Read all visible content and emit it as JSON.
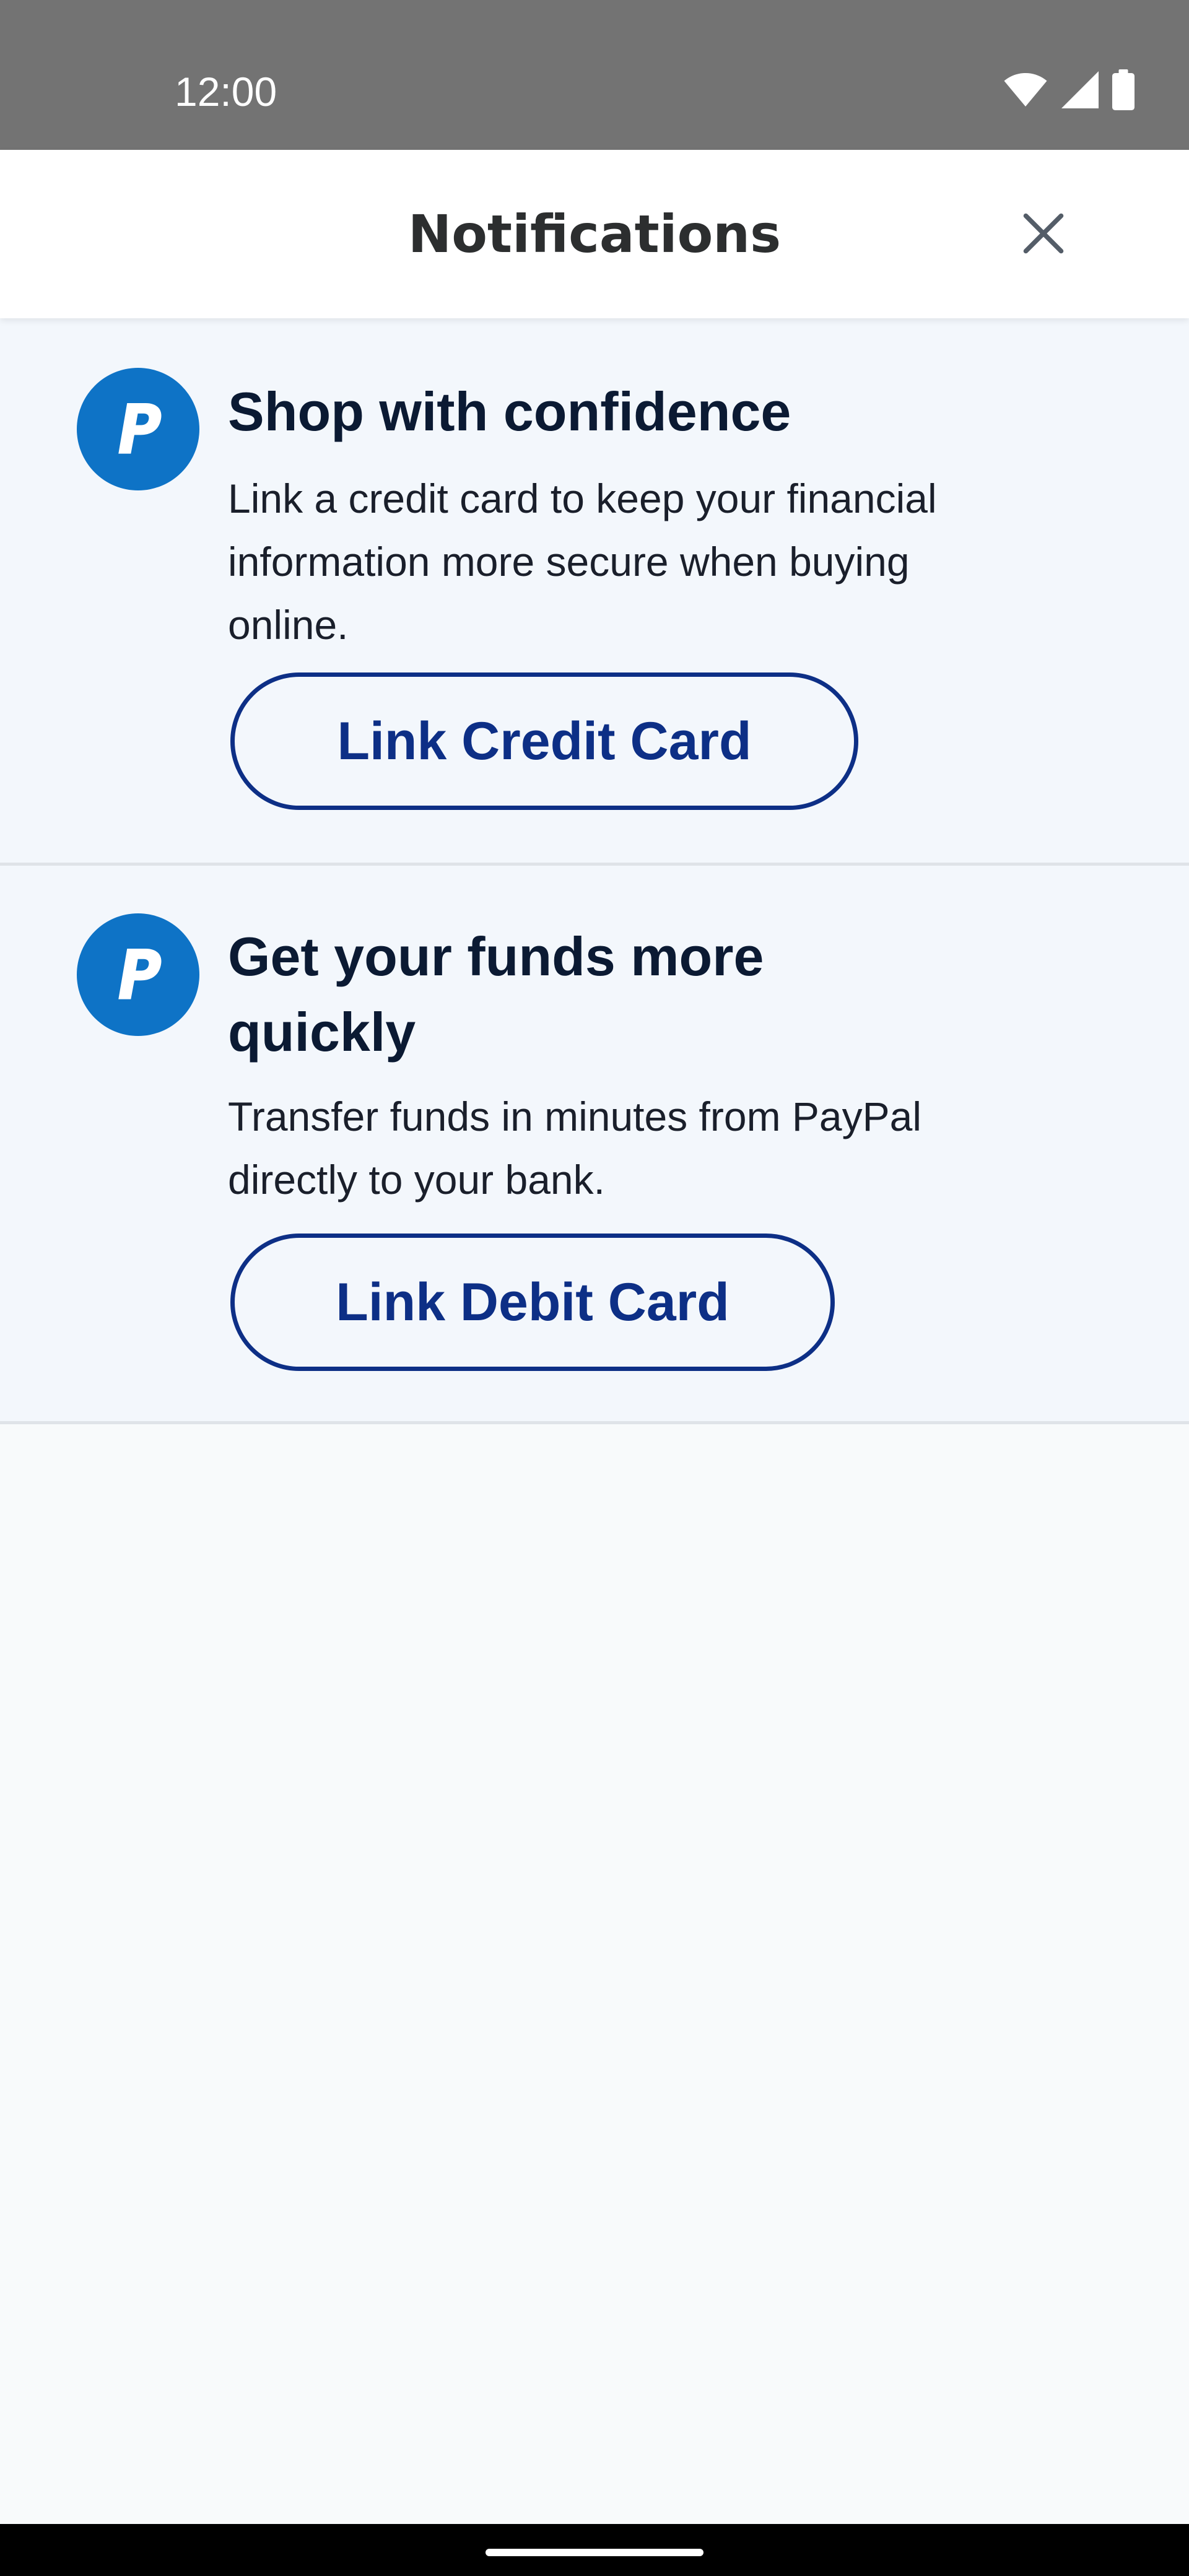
{
  "status_bar": {
    "time": "12:00",
    "icons": [
      "wifi-icon",
      "cellular-signal-icon",
      "battery-icon"
    ]
  },
  "header": {
    "title": "Notifications",
    "close_icon": "close-icon"
  },
  "notifications": [
    {
      "icon": "paypal-logo-icon",
      "title": "Shop with confidence",
      "body": "Link a credit card to keep your financial information more secure when buying online.",
      "button_label": "Link Credit Card"
    },
    {
      "icon": "paypal-logo-icon",
      "title": "Get your funds more quickly",
      "body": "Transfer funds in minutes from PayPal directly to your bank.",
      "button_label": "Link Debit Card"
    }
  ],
  "colors": {
    "status_bar": "#737373",
    "brand_blue": "#0e73c6",
    "button_navy": "#0d2f86",
    "card_background": "#f3f7fc",
    "page_background": "#f8fafb"
  }
}
